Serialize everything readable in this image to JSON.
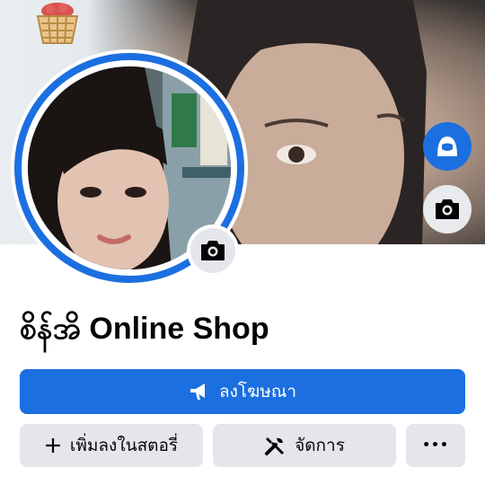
{
  "page": {
    "name": "စိန်အိ Online Shop"
  },
  "buttons": {
    "promote_label": "ลงโฆษณา",
    "add_to_story_label": "เพิ่มลงในสตอรี่",
    "manage_label": "จัดการ",
    "more_label": "•••"
  },
  "icons": {
    "promote": "megaphone-icon",
    "add": "plus-icon",
    "manage": "tools-icon",
    "cover_avatar": "avatar-icon",
    "cover_camera": "camera-icon",
    "profile_camera": "camera-icon"
  },
  "colors": {
    "primary": "#1b6fe0",
    "secondary_bg": "#e4e6eb",
    "text": "#050505"
  }
}
